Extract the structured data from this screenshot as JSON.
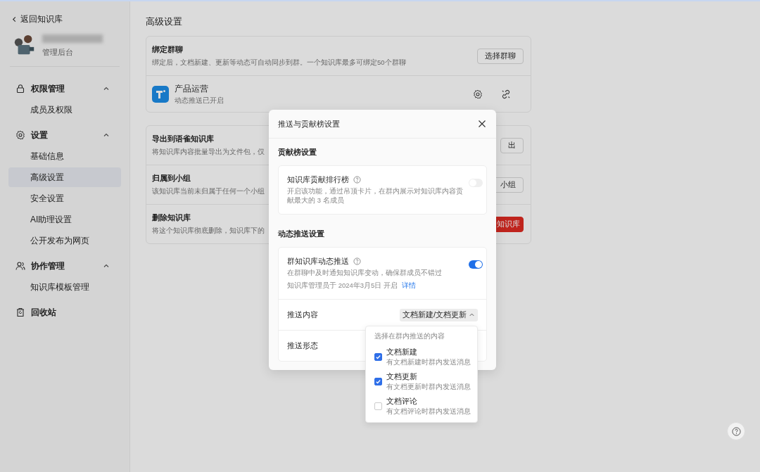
{
  "sidebar": {
    "back_link": "返回知识库",
    "subtitle": "管理后台",
    "groups": [
      {
        "kind": "lock",
        "title": "权限管理",
        "expanded": true,
        "items": [
          {
            "label": "成员及权限",
            "selected": false
          }
        ]
      },
      {
        "kind": "gear",
        "title": "设置",
        "expanded": true,
        "items": [
          {
            "label": "基础信息",
            "selected": false
          },
          {
            "label": "高级设置",
            "selected": true
          },
          {
            "label": "安全设置",
            "selected": false
          },
          {
            "label": "AI助理设置",
            "selected": false
          },
          {
            "label": "公开发布为网页",
            "selected": false
          }
        ]
      },
      {
        "kind": "people",
        "title": "协作管理",
        "expanded": true,
        "items": [
          {
            "label": "知识库模板管理",
            "selected": false
          }
        ]
      }
    ],
    "footer": "回收站"
  },
  "page": {
    "title": "高级设置",
    "bind": {
      "title": "绑定群聊",
      "description": "绑定后，文档新建、更新等动态可自动同步到群。一个知识库最多可绑定50个群聊",
      "button": "选择群聊",
      "group_name": "产品运营",
      "group_status": "动态推送已开启"
    },
    "rows": [
      {
        "kind": "normal",
        "title": "导出到语雀知识库",
        "description": "将知识库内容批量导出为文件包，仅",
        "button": "出"
      },
      {
        "kind": "normal",
        "title": "归属到小组",
        "description": "该知识库当前未归属于任何一个小组",
        "button": "小组"
      },
      {
        "kind": "danger",
        "title": "删除知识库",
        "description": "将这个知识库彻底删除，知识库下的",
        "button": "知识库"
      }
    ]
  },
  "modal": {
    "title": "推送与贡献榜设置",
    "leaderboard": {
      "heading": "贡献榜设置",
      "title": "知识库贡献排行榜",
      "description": "开启该功能，通过吊顶卡片，在群内展示对知识库内容贡献最大的 3 名成员",
      "on": false
    },
    "push": {
      "heading": "动态推送设置",
      "title": "群知识库动态推送",
      "description": "在群聊中及时通知知识库变动，确保群成员不错过",
      "meta": "知识库管理员于 2024年3月5日 开启",
      "link": "详情",
      "on": true,
      "content_label": "推送内容",
      "content_value": "文档新建/文档更新",
      "form_label": "推送形态"
    }
  },
  "dropdown": {
    "expanded": true,
    "hint": "选择在群内推送的内容",
    "options": [
      {
        "label": "文档新建",
        "description": "有文档新建时群内发送消息",
        "checked": true
      },
      {
        "label": "文档更新",
        "description": "有文档更新时群内发送消息",
        "checked": true
      },
      {
        "label": "文档评论",
        "description": "有文档评论时群内发送消息",
        "checked": false
      }
    ]
  }
}
